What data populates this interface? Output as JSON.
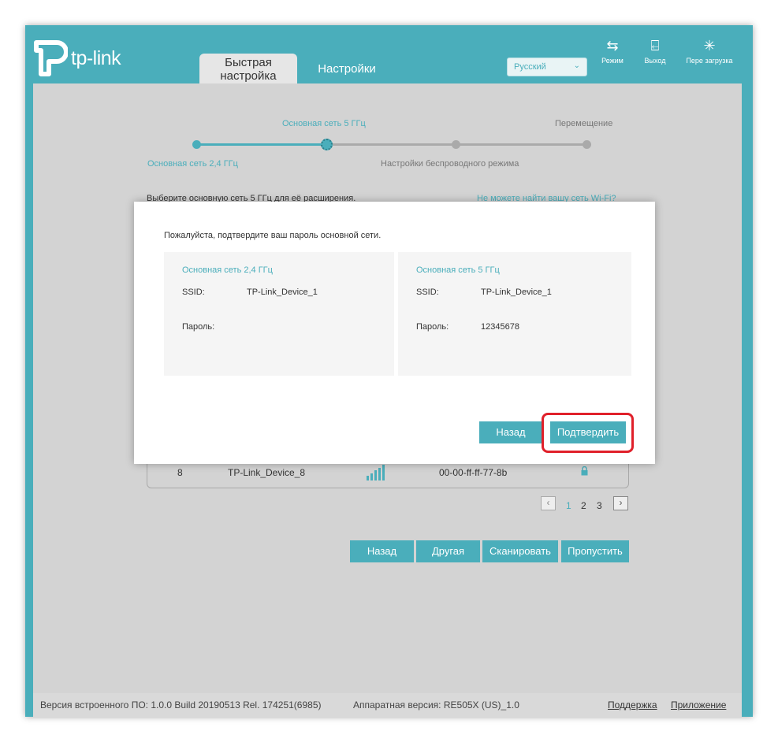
{
  "header": {
    "logo_text": "tp-link",
    "tabs": [
      {
        "label": "Быстрая\nнастройка"
      },
      {
        "label": "Настройки"
      }
    ],
    "language": "Русский",
    "actions": [
      {
        "label": "Режим",
        "icon": "mode-switch-icon"
      },
      {
        "label": "Выход",
        "icon": "logout-icon"
      },
      {
        "label": "Пере загрузка",
        "icon": "reboot-icon"
      }
    ]
  },
  "wizard": {
    "steps": {
      "step1": "Основная сеть 2,4 ГГц",
      "step2": "Основная сеть 5 ГГц",
      "step3": "Настройки беспроводного режима",
      "step4": "Перемещение"
    },
    "instruction": "Выберите основную сеть 5 ГГц для её расширения.",
    "cant_find": "Не можете найти вашу сеть Wi-Fi?",
    "row": {
      "num": "8",
      "ssid": "TP-Link_Device_8",
      "mac": "00-00-ff-ff-77-8b"
    },
    "pagination": {
      "prev": "‹",
      "pages": [
        "1",
        "2",
        "3"
      ],
      "next": "›"
    },
    "buttons": {
      "back": "Назад",
      "other": "Другая",
      "scan": "Сканировать",
      "skip": "Пропустить"
    }
  },
  "dialog": {
    "title": "Пожалуйста, подтвердите ваш пароль основной сети.",
    "panel_24": {
      "title": "Основная сеть 2,4 ГГц",
      "ssid_label": "SSID:",
      "ssid": "TP-Link_Device_1",
      "pass_label": "Пароль:",
      "pass": ""
    },
    "panel_5": {
      "title": "Основная сеть 5 ГГц",
      "ssid_label": "SSID:",
      "ssid": "TP-Link_Device_1",
      "pass_label": "Пароль:",
      "pass": "12345678"
    },
    "back": "Назад",
    "confirm": "Подтвердить"
  },
  "footer": {
    "firmware": "Версия встроенного ПО: 1.0.0 Build 20190513 Rel. 174251(6985)",
    "hardware": "Аппаратная версия: RE505X (US)_1.0",
    "support": "Поддержка",
    "app": "Приложение"
  },
  "colors": {
    "accent": "#4aaebb",
    "highlight": "#e0202a"
  }
}
